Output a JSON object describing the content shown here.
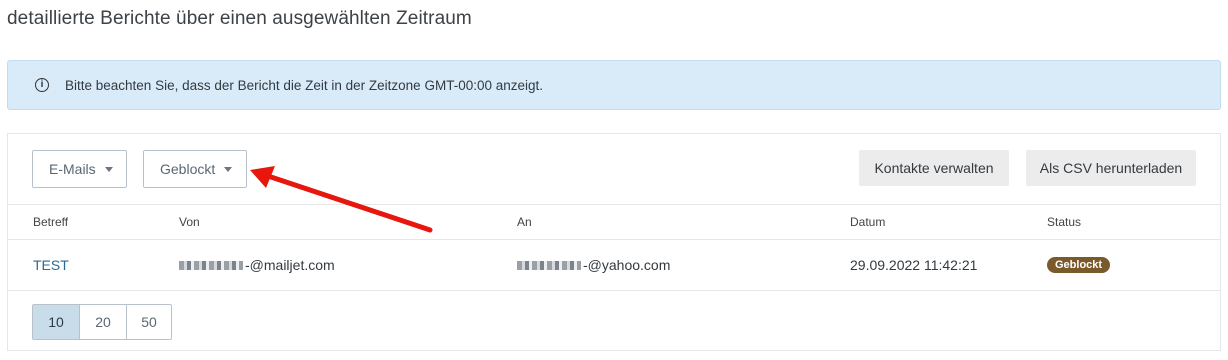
{
  "page": {
    "heading": "detaillierte Berichte über einen ausgewählten Zeitraum"
  },
  "notice": {
    "icon": "info-icon",
    "text": "Bitte beachten Sie, dass der Bericht die Zeit in der Zeitzone GMT-00:00 anzeigt."
  },
  "filters": {
    "type_label": "E-Mails",
    "status_label": "Geblockt"
  },
  "actions": {
    "manage_contacts": "Kontakte verwalten",
    "download_csv": "Als CSV herunterladen"
  },
  "table": {
    "columns": [
      "Betreff",
      "Von",
      "An",
      "Datum",
      "Status"
    ],
    "rows": [
      {
        "subject": "TEST",
        "from": "-@mailjet.com",
        "to": "-@yahoo.com",
        "date": "29.09.2022 11:42:21",
        "status": "Geblockt"
      }
    ]
  },
  "pagination": {
    "sizes": [
      "10",
      "20",
      "50"
    ],
    "selected": "10"
  },
  "colors": {
    "notice_bg": "#d9ebf9",
    "badge_bg": "#7a5a2a",
    "annotation_arrow": "#e8160c",
    "subject_link": "#2b6a93"
  }
}
